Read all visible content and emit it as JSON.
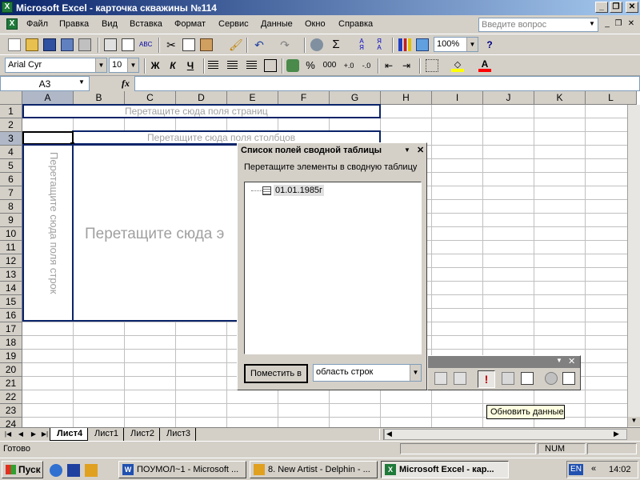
{
  "window": {
    "title": "Microsoft Excel - карточка скважины №114"
  },
  "menu": {
    "items": [
      "Файл",
      "Правка",
      "Вид",
      "Вставка",
      "Формат",
      "Сервис",
      "Данные",
      "Окно",
      "Справка"
    ],
    "ask_placeholder": "Введите вопрос"
  },
  "toolbar": {
    "zoom": "100%"
  },
  "format_bar": {
    "font": "Arial Cyr",
    "size": "10",
    "bold": "Ж",
    "italic": "К",
    "underline": "Ч",
    "percent": "%",
    "thousands": "000"
  },
  "formula_bar": {
    "name_box": "A3",
    "fx": "fx",
    "formula": ""
  },
  "grid": {
    "columns": [
      "A",
      "B",
      "C",
      "D",
      "E",
      "F",
      "G",
      "H",
      "I",
      "J",
      "K",
      "L"
    ],
    "rows": [
      "1",
      "2",
      "3",
      "4",
      "5",
      "6",
      "7",
      "8",
      "9",
      "10",
      "11",
      "12",
      "13",
      "14",
      "15",
      "16",
      "17",
      "18",
      "19",
      "20",
      "21",
      "22",
      "23",
      "24"
    ]
  },
  "pivot": {
    "page_fields": "Перетащите сюда поля страниц",
    "column_fields": "Перетащите сюда поля столбцов",
    "row_fields": "Перетащите сюда поля строк",
    "data_items": "Перетащите сюда э"
  },
  "field_list": {
    "title": "Список полей сводной таблицы",
    "instruction": "Перетащите элементы в сводную таблицу",
    "items": [
      "01.01.1985г"
    ],
    "add_button": "Поместить в",
    "area": "область строк"
  },
  "tooltip": {
    "text": "Обновить данные"
  },
  "sheets": {
    "tabs": [
      "Лист4",
      "Лист1",
      "Лист2",
      "Лист3"
    ],
    "active": "Лист4"
  },
  "status": {
    "left": "Готово",
    "num": "NUM"
  },
  "taskbar": {
    "start": "Пуск",
    "tasks": [
      "ПОУМОЛ~1 - Microsoft ...",
      "8. New Artist - Delphin - ...",
      "Microsoft Excel - кар..."
    ],
    "lang": "EN",
    "clock": "14:02"
  }
}
